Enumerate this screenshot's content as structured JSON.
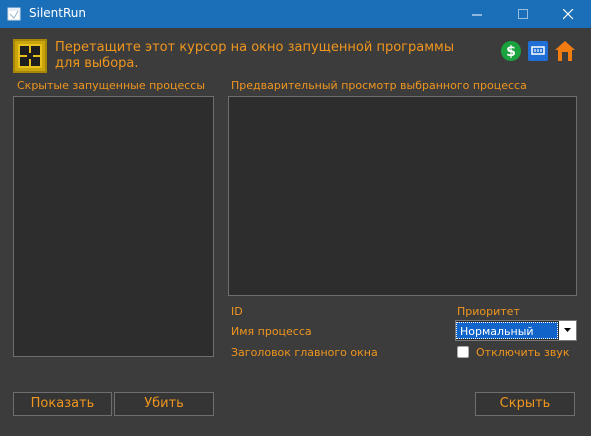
{
  "window": {
    "title": "SilentRun"
  },
  "header": {
    "instruction": "Перетащите этот курсор на окно запущенной программы для выбора.",
    "icons": [
      "crosshair-icon",
      "dollar-icon",
      "blog-icon",
      "home-icon"
    ]
  },
  "left_panel": {
    "label": "Скрытые запущенные процессы"
  },
  "preview_panel": {
    "label": "Предварительный просмотр выбранного процесса"
  },
  "details": {
    "id_label": "ID",
    "process_name_label": "Имя процесса",
    "window_caption_label": "Заголовок главного окна"
  },
  "priority": {
    "label": "Приоритет",
    "selected": "Нормальный"
  },
  "mute": {
    "label": "Отключить звук",
    "checked": false
  },
  "buttons": {
    "show": "Показать",
    "kill": "Убить",
    "hide": "Скрыть"
  },
  "colors": {
    "accent": "#f0961e",
    "titlebar": "#1b6fb8",
    "background": "#3c3c3c",
    "panel": "#2d2d2d"
  }
}
